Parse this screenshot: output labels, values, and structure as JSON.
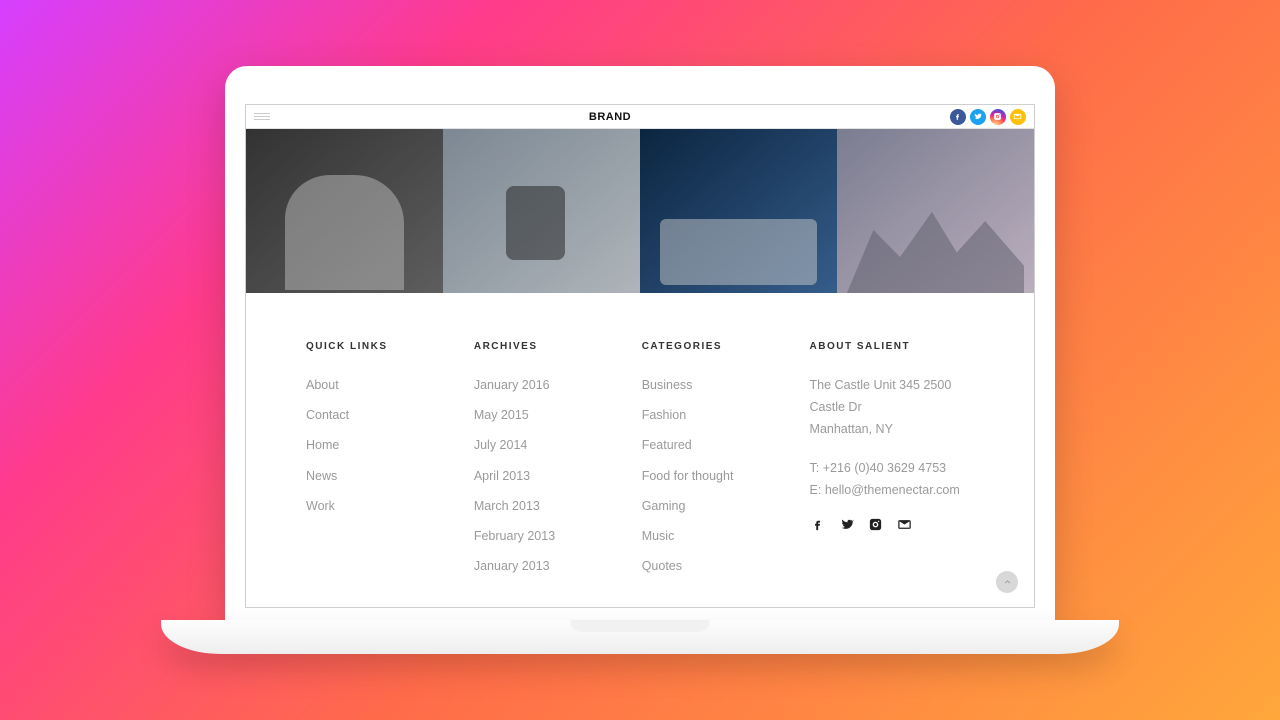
{
  "header": {
    "brand": "BRAND"
  },
  "footer": {
    "quicklinks": {
      "title": "QUICK LINKS",
      "items": [
        "About",
        "Contact",
        "Home",
        "News",
        "Work"
      ]
    },
    "archives": {
      "title": "ARCHIVES",
      "items": [
        "January 2016",
        "May 2015",
        "July 2014",
        "April 2013",
        "March 2013",
        "February 2013",
        "January 2013"
      ]
    },
    "categories": {
      "title": "CATEGORIES",
      "items": [
        "Business",
        "Fashion",
        "Featured",
        "Food for thought",
        "Gaming",
        "Music",
        "Quotes"
      ]
    },
    "about": {
      "title": "ABOUT SALIENT",
      "addr1": "The Castle Unit 345 2500",
      "addr2": "Castle Dr",
      "addr3": "Manhattan, NY",
      "tel": "T: +216 (0)40 3629 4753",
      "email": "E: hello@themenectar.com"
    }
  }
}
